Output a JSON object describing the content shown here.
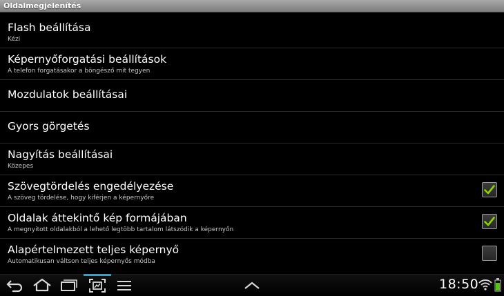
{
  "window": {
    "title": "Oldalmegjelenítés"
  },
  "settings": [
    {
      "title": "Flash beállítása",
      "subtitle": "Kézi",
      "checkbox": null
    },
    {
      "title": "Képernyőforgatási beállítások",
      "subtitle": "A telefon forgatásakor a böngésző mit tegyen",
      "checkbox": null
    },
    {
      "title": "Mozdulatok beállításai",
      "subtitle": "",
      "checkbox": null
    },
    {
      "title": "Gyors görgetés",
      "subtitle": "",
      "checkbox": null
    },
    {
      "title": "Nagyítás beállításai",
      "subtitle": "Közepes",
      "checkbox": null
    },
    {
      "title": "Szövegtördelés engedélyezése",
      "subtitle": "A szöveg tördelése, hogy kiférjen a képernyőre",
      "checkbox": true
    },
    {
      "title": "Oldalak áttekintő kép formájában",
      "subtitle": "A megnyitott oldalakból a lehető legtöbb tartalom látszódik a képernyőn",
      "checkbox": true
    },
    {
      "title": "Alapértelmezett teljes képernyő",
      "subtitle": "Automatikusan váltson teljes képernyős módba",
      "checkbox": false
    }
  ],
  "navbar": {
    "icons": [
      "back-icon",
      "home-icon",
      "recent-apps-icon",
      "screenshot-icon",
      "menu-icon",
      "chevron-up-icon"
    ]
  },
  "status": {
    "time": "18:50",
    "icons": [
      "wifi-icon",
      "battery-icon"
    ]
  },
  "colors": {
    "check": "#8fd400",
    "accent": "#2aa3d8",
    "battery": "#56c11b"
  }
}
